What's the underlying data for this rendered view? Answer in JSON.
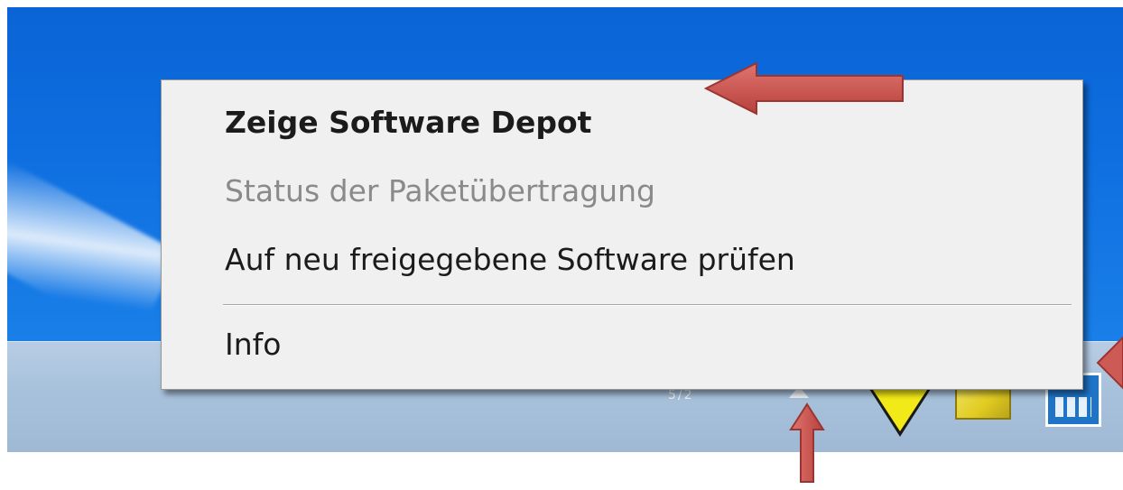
{
  "context_menu": {
    "items": [
      {
        "label": "Zeige Software Depot",
        "style": "bold",
        "enabled": true
      },
      {
        "label": "Status der Paketübertragung",
        "style": "normal",
        "enabled": false
      },
      {
        "label": "Auf neu freigegebene Software prüfen",
        "style": "normal",
        "enabled": true
      },
      {
        "label": "Info",
        "style": "normal",
        "enabled": true
      }
    ]
  },
  "taskbar": {
    "clock_fragment": "5/2",
    "tray_icons": [
      "show-hidden-icons-arrow",
      "warning-icon",
      "folder-icon",
      "network-icon"
    ]
  },
  "colors": {
    "desktop": "#0f6fe0",
    "taskbar": "#a9c2dc",
    "menu_background": "#f0f0f0",
    "disabled_text": "#8a8a8a",
    "callout_arrow": "#c0504d"
  }
}
